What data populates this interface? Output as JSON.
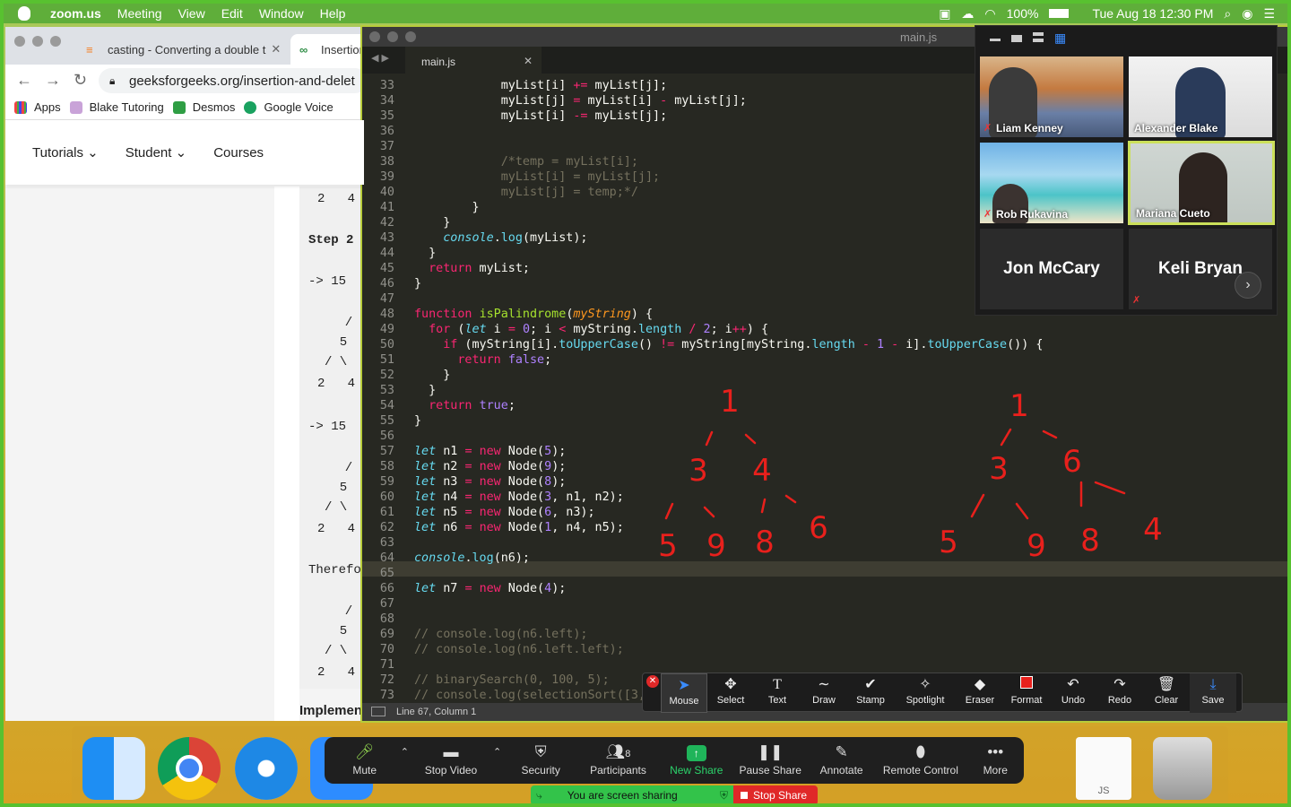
{
  "menubar": {
    "app": "zoom.us",
    "items": [
      "Meeting",
      "View",
      "Edit",
      "Window",
      "Help"
    ],
    "battery": "100%",
    "clock": "Tue Aug 18  12:30 PM"
  },
  "browser": {
    "tabs": [
      {
        "label": "casting - Converting a double t"
      },
      {
        "label": "Insertion"
      }
    ],
    "url": "geeksforgeeks.org/insertion-and-delet",
    "bookmarks": [
      "Apps",
      "Blake Tutoring",
      "Desmos",
      "Google Voice"
    ],
    "nav": [
      "Tutorials",
      "Student",
      "Courses"
    ],
    "code_lines": [
      "2   4",
      "Step 2",
      "-> 15",
      "  /",
      "  5",
      "/ \\",
      "2   4",
      "-> 15",
      "  /",
      "  5",
      "/ \\",
      "2   4",
      "Therefo",
      "  /",
      "  5",
      "/ \\",
      "2   4"
    ],
    "footer": "Implemen"
  },
  "editor": {
    "window_title": "main.js",
    "tab": "main.js",
    "status": "Line 67, Column 1",
    "lines": [
      {
        "n": "33",
        "code": "            myList[i] += myList[j];"
      },
      {
        "n": "34",
        "code": "            myList[j] = myList[i] - myList[j];"
      },
      {
        "n": "35",
        "code": "            myList[i] -= myList[j];"
      },
      {
        "n": "36",
        "code": ""
      },
      {
        "n": "37",
        "code": ""
      },
      {
        "n": "38",
        "code": "            /*temp = myList[i];"
      },
      {
        "n": "39",
        "code": "            myList[i] = myList[j];"
      },
      {
        "n": "40",
        "code": "            myList[j] = temp;*/"
      },
      {
        "n": "41",
        "code": "        }"
      },
      {
        "n": "42",
        "code": "    }"
      },
      {
        "n": "43",
        "code": "    console.log(myList);"
      },
      {
        "n": "44",
        "code": "  }"
      },
      {
        "n": "45",
        "code": "  return myList;"
      },
      {
        "n": "46",
        "code": "}"
      },
      {
        "n": "47",
        "code": ""
      },
      {
        "n": "48",
        "code": "function isPalindrome(myString) {"
      },
      {
        "n": "49",
        "code": "  for (let i = 0; i < myString.length / 2; i++) {"
      },
      {
        "n": "50",
        "code": "    if (myString[i].toUpperCase() != myString[myString.length - 1 - i].toUpperCase()) {"
      },
      {
        "n": "51",
        "code": "      return false;"
      },
      {
        "n": "52",
        "code": "    }"
      },
      {
        "n": "53",
        "code": "  }"
      },
      {
        "n": "54",
        "code": "  return true;"
      },
      {
        "n": "55",
        "code": "}"
      },
      {
        "n": "56",
        "code": ""
      },
      {
        "n": "57",
        "code": "let n1 = new Node(5);"
      },
      {
        "n": "58",
        "code": "let n2 = new Node(9);"
      },
      {
        "n": "59",
        "code": "let n3 = new Node(8);"
      },
      {
        "n": "60",
        "code": "let n4 = new Node(3, n1, n2);"
      },
      {
        "n": "61",
        "code": "let n5 = new Node(6, n3);"
      },
      {
        "n": "62",
        "code": "let n6 = new Node(1, n4, n5);"
      },
      {
        "n": "63",
        "code": ""
      },
      {
        "n": "64",
        "code": "console.log(n6);"
      },
      {
        "n": "65",
        "code": ""
      },
      {
        "n": "66",
        "code": "let n7 = new Node(4);"
      },
      {
        "n": "67",
        "code": ""
      },
      {
        "n": "68",
        "code": ""
      },
      {
        "n": "69",
        "code": "// console.log(n6.left);"
      },
      {
        "n": "70",
        "code": "// console.log(n6.left.left);"
      },
      {
        "n": "71",
        "code": ""
      },
      {
        "n": "72",
        "code": "// binarySearch(0, 100, 5);"
      },
      {
        "n": "73",
        "code": "// console.log(selectionSort([3,"
      }
    ]
  },
  "annotations": {
    "tree1": [
      "1",
      "3",
      "4",
      "5",
      "9",
      "8",
      "6"
    ],
    "tree2": [
      "1",
      "3",
      "6",
      "5",
      "9",
      "8",
      "4"
    ],
    "color": "#e8201c"
  },
  "gallery": [
    {
      "name": "Liam Kenney"
    },
    {
      "name": "Alexander Blake"
    },
    {
      "name": "Rob Rukavina"
    },
    {
      "name": "Mariana Cueto"
    },
    {
      "name": "Jon McCary"
    },
    {
      "name": "Keli Bryan"
    }
  ],
  "annotate_tools": [
    "Mouse",
    "Select",
    "Text",
    "Draw",
    "Stamp",
    "Spotlight",
    "Eraser",
    "Format",
    "Undo",
    "Redo",
    "Clear",
    "Save"
  ],
  "zoom_controls": {
    "buttons": [
      "Mute",
      "Stop Video",
      "Security",
      "Participants",
      "New Share",
      "Pause Share",
      "Annotate",
      "Remote Control",
      "More"
    ],
    "participants_count": "8",
    "sharing_text": "You are screen sharing",
    "stop_share": "Stop Share"
  },
  "dock": {
    "file_label": "JS"
  }
}
